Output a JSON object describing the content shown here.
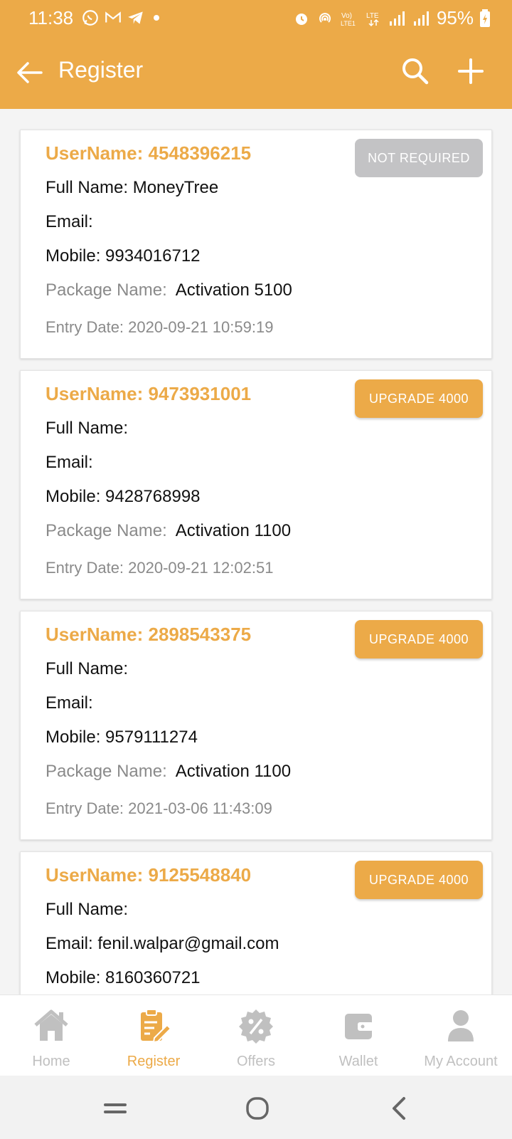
{
  "status_bar": {
    "time": "11:38",
    "battery": "95%",
    "left_icons": [
      "whatsapp-icon",
      "gmail-icon",
      "telegram-icon",
      "dot-icon"
    ],
    "right_icons": [
      "alarm-icon",
      "hotspot-icon",
      "volte-icon",
      "lte-icon",
      "signal-icon",
      "signal-icon",
      "battery-icon"
    ]
  },
  "toolbar": {
    "title": "Register",
    "background": "#ecaa48"
  },
  "cards": [
    {
      "username": "UserName: 4548396215",
      "badge": "NOT REQUIRED",
      "full_name": "Full Name: MoneyTree",
      "email": "Email:",
      "mobile": "Mobile: 9934016712",
      "package_label": "Package Name:",
      "package_value": "Activation 5100",
      "entry_date": "Entry Date: 2020-09-21 10:59:19"
    },
    {
      "username": "UserName: 9473931001",
      "badge": "UPGRADE 4000",
      "full_name": "Full Name:",
      "email": "Email:",
      "mobile": "Mobile: 9428768998",
      "package_label": "Package Name:",
      "package_value": "Activation 1100",
      "entry_date": "Entry Date: 2020-09-21 12:02:51"
    },
    {
      "username": "UserName: 2898543375",
      "badge": "UPGRADE 4000",
      "full_name": "Full Name:",
      "email": "Email:",
      "mobile": "Mobile: 9579111274",
      "package_label": "Package Name:",
      "package_value": "Activation 1100",
      "entry_date": "Entry Date: 2021-03-06 11:43:09"
    },
    {
      "username": "UserName: 9125548840",
      "badge": "UPGRADE 4000",
      "full_name": "Full Name:",
      "email": "Email: fenil.walpar@gmail.com",
      "mobile": "Mobile: 8160360721"
    }
  ],
  "bottom_nav": {
    "items": [
      {
        "label": "Home",
        "icon": "home-icon",
        "active": false
      },
      {
        "label": "Register",
        "icon": "register-icon",
        "active": true
      },
      {
        "label": "Offers",
        "icon": "offers-icon",
        "active": false
      },
      {
        "label": "Wallet",
        "icon": "wallet-icon",
        "active": false
      },
      {
        "label": "My Account",
        "icon": "account-icon",
        "active": false
      }
    ],
    "active_color": "#ecaa48",
    "inactive_color": "#c0c0c0"
  },
  "system_nav": [
    "recents-icon",
    "home-circle-icon",
    "back-chevron-icon"
  ]
}
